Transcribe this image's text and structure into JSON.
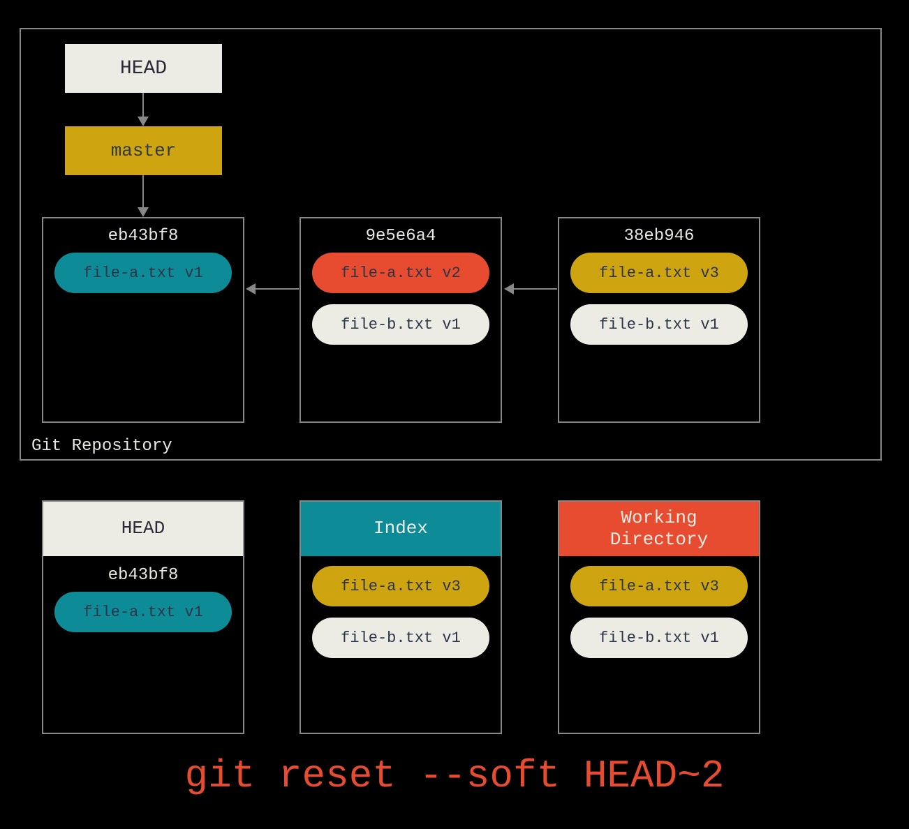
{
  "repo": {
    "label": "Git Repository",
    "head": "HEAD",
    "master": "master",
    "commits": [
      {
        "hash": "eb43bf8",
        "files": [
          {
            "name": "file-a.txt v1",
            "tone": "teal"
          }
        ]
      },
      {
        "hash": "9e5e6a4",
        "files": [
          {
            "name": "file-a.txt v2",
            "tone": "orange"
          },
          {
            "name": "file-b.txt v1",
            "tone": "gray"
          }
        ]
      },
      {
        "hash": "38eb946",
        "files": [
          {
            "name": "file-a.txt v3",
            "tone": "gold"
          },
          {
            "name": "file-b.txt v1",
            "tone": "gray"
          }
        ]
      }
    ]
  },
  "trees": {
    "head": {
      "title": "HEAD",
      "hash": "eb43bf8",
      "files": [
        {
          "name": "file-a.txt v1",
          "tone": "teal"
        }
      ]
    },
    "index": {
      "title": "Index",
      "files": [
        {
          "name": "file-a.txt v3",
          "tone": "gold"
        },
        {
          "name": "file-b.txt v1",
          "tone": "gray"
        }
      ]
    },
    "workdir": {
      "title": "Working Directory",
      "files": [
        {
          "name": "file-a.txt v3",
          "tone": "gold"
        },
        {
          "name": "file-b.txt v1",
          "tone": "gray"
        }
      ]
    }
  },
  "command": "git reset --soft HEAD~2"
}
